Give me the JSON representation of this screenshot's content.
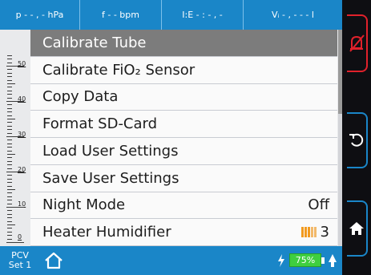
{
  "top_bar": [
    {
      "text": "p - - , -  hPa"
    },
    {
      "text": "f - -  bpm"
    },
    {
      "text": "I:E - : - , -"
    },
    {
      "text": "Vᵢ - , - - -  l"
    }
  ],
  "scale_labels": [
    "50",
    "40",
    "30",
    "20",
    "10",
    "0"
  ],
  "menu_items": [
    {
      "label": "Calibrate Tube",
      "value": ""
    },
    {
      "label": "Calibrate FiO₂ Sensor",
      "value": ""
    },
    {
      "label": "Copy Data",
      "value": ""
    },
    {
      "label": "Format SD-Card",
      "value": ""
    },
    {
      "label": "Load User Settings",
      "value": ""
    },
    {
      "label": "Save User Settings",
      "value": ""
    },
    {
      "label": "Night Mode",
      "value": "Off"
    },
    {
      "label": "Heater Humidifier",
      "value": "3"
    }
  ],
  "humidifier_level": 3,
  "humidifier_level_max": 5,
  "bottom_bar": {
    "mode_line1": "PCV",
    "mode_line2": "Set 1",
    "battery_percent": "75%",
    "battery_level": 0.75
  },
  "colors": {
    "accent_blue": "#1a86c8",
    "selected_gray": "#7c7c7c",
    "alarm_red": "#e0212b",
    "battery_green": "#3fcf3f",
    "humidifier_orange": "#f29a1e"
  },
  "icons": [
    "alarm-mute-icon",
    "rotate-icon",
    "home-icon",
    "home-outline-icon",
    "charging-bolt-icon",
    "battery-icon",
    "power-plug-icon"
  ]
}
